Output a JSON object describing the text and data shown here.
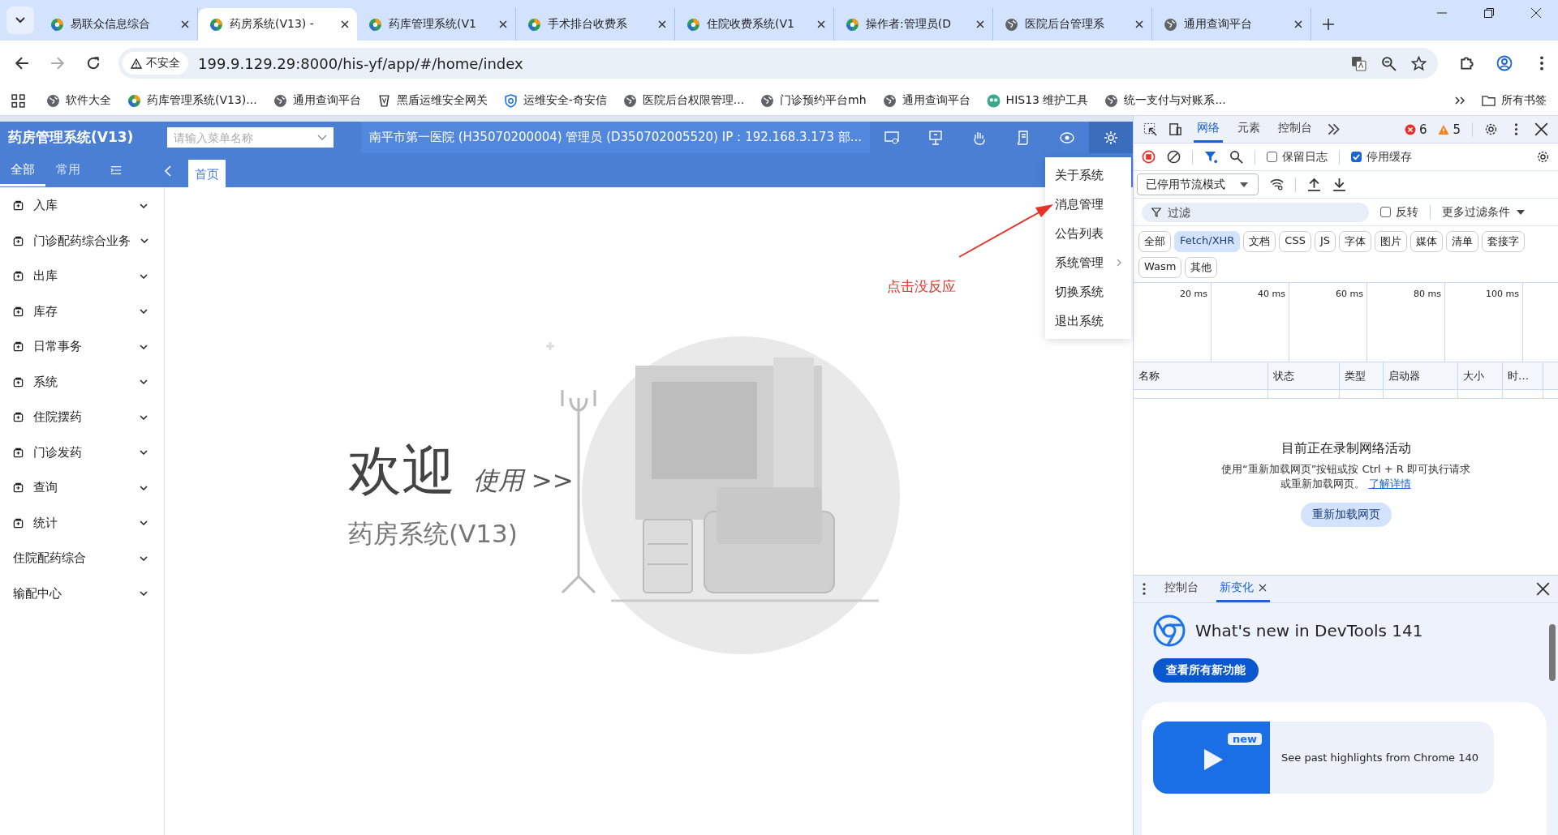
{
  "browser": {
    "tabs": [
      {
        "title": "易联众信息综合",
        "kind": "app",
        "selected": false
      },
      {
        "title": "药房系统(V13) -",
        "kind": "app",
        "selected": true
      },
      {
        "title": "药库管理系统(V1",
        "kind": "app",
        "selected": false
      },
      {
        "title": "手术排台收费系",
        "kind": "app",
        "selected": false
      },
      {
        "title": "住院收费系统(V1",
        "kind": "app",
        "selected": false
      },
      {
        "title": "操作者:管理员(D",
        "kind": "app",
        "selected": false
      },
      {
        "title": "医院后台管理系",
        "kind": "site",
        "selected": false
      },
      {
        "title": "通用查询平台",
        "kind": "site",
        "selected": false
      }
    ],
    "address": {
      "security": "不安全",
      "url": "199.9.129.29:8000/his-yf/app/#/home/index"
    },
    "bookmarks": [
      {
        "label": "软件大全",
        "kind": "site"
      },
      {
        "label": "药库管理系统(V13)...",
        "kind": "app"
      },
      {
        "label": "通用查询平台",
        "kind": "site"
      },
      {
        "label": "黑盾运维安全网关",
        "kind": "badge"
      },
      {
        "label": "运维安全-奇安信",
        "kind": "shield"
      },
      {
        "label": "医院后台权限管理...",
        "kind": "site"
      },
      {
        "label": "门诊预约平台mh",
        "kind": "site"
      },
      {
        "label": "通用查询平台",
        "kind": "site"
      },
      {
        "label": "HIS13 维护工具",
        "kind": "tool"
      },
      {
        "label": "统一支付与对账系...",
        "kind": "site"
      }
    ],
    "all_bookmarks": "所有书签"
  },
  "app": {
    "title": "药房管理系统(V13)",
    "search": {
      "placeholder": "请输入菜单名称"
    },
    "info": "南平市第一医院 (H35070200004) 管理员 (D350702005520) IP：192.168.3.173 部...",
    "sidebar_tabs": [
      {
        "label": "全部",
        "selected": true
      },
      {
        "label": "常用",
        "selected": false
      }
    ],
    "page_tabs": [
      {
        "label": "首页",
        "selected": true
      }
    ],
    "menu": [
      {
        "label": "入库",
        "icon": true
      },
      {
        "label": "门诊配药综合业务",
        "icon": true
      },
      {
        "label": "出库",
        "icon": true
      },
      {
        "label": "库存",
        "icon": true
      },
      {
        "label": "日常事务",
        "icon": true
      },
      {
        "label": "系统",
        "icon": true
      },
      {
        "label": "住院摆药",
        "icon": true
      },
      {
        "label": "门诊发药",
        "icon": true
      },
      {
        "label": "查询",
        "icon": true
      },
      {
        "label": "统计",
        "icon": true
      },
      {
        "label": "住院配药综合",
        "icon": false
      },
      {
        "label": "输配中心",
        "icon": false
      }
    ],
    "welcome": {
      "heading": "欢迎",
      "sub": "使用 >>",
      "system": "药房系统(V13)"
    },
    "settings_menu": [
      {
        "label": "关于系统",
        "submenu": false
      },
      {
        "label": "消息管理",
        "submenu": false
      },
      {
        "label": "公告列表",
        "submenu": false
      },
      {
        "label": "系统管理",
        "submenu": true
      },
      {
        "label": "切换系统",
        "submenu": false
      },
      {
        "label": "退出系统",
        "submenu": false
      }
    ],
    "annotation": "点击没反应"
  },
  "devtools": {
    "tabs": [
      {
        "label": "网络",
        "selected": true
      },
      {
        "label": "元素",
        "selected": false
      },
      {
        "label": "控制台",
        "selected": false
      }
    ],
    "errors": "6",
    "warnings": "5",
    "preserve_log": {
      "label": "保留日志",
      "checked": false
    },
    "disable_cache": {
      "label": "停用缓存",
      "checked": true
    },
    "throttling": "已停用节流模式",
    "filter": {
      "placeholder": "过滤"
    },
    "invert": {
      "label": "反转",
      "checked": false
    },
    "more_filters": "更多过滤条件",
    "types": [
      {
        "label": "全部",
        "selected": false
      },
      {
        "label": "Fetch/XHR",
        "selected": true
      },
      {
        "label": "文档",
        "selected": false
      },
      {
        "label": "CSS",
        "selected": false
      },
      {
        "label": "JS",
        "selected": false
      },
      {
        "label": "字体",
        "selected": false
      },
      {
        "label": "图片",
        "selected": false
      },
      {
        "label": "媒体",
        "selected": false
      },
      {
        "label": "清单",
        "selected": false
      },
      {
        "label": "套接字",
        "selected": false
      },
      {
        "label": "Wasm",
        "selected": false
      },
      {
        "label": "其他",
        "selected": false
      }
    ],
    "ticks": [
      "20 ms",
      "40 ms",
      "60 ms",
      "80 ms",
      "100 ms"
    ],
    "columns": [
      "名称",
      "状态",
      "类型",
      "启动器",
      "大小",
      "时…"
    ],
    "empty": {
      "title": "目前正在录制网络活动",
      "description": "使用“重新加载网页”按钮或按 Ctrl + R 即可执行请求或重新加载网页。",
      "link": "了解详情",
      "button": "重新加载网页"
    },
    "drawer_tabs": [
      {
        "label": "控制台",
        "selected": false,
        "closable": false
      },
      {
        "label": "新变化",
        "selected": true,
        "closable": true
      }
    ],
    "whats_new": {
      "title": "What's new in DevTools 141",
      "button": "查看所有新功能",
      "badge": "new",
      "highlight": "See past highlights from Chrome 140"
    }
  }
}
